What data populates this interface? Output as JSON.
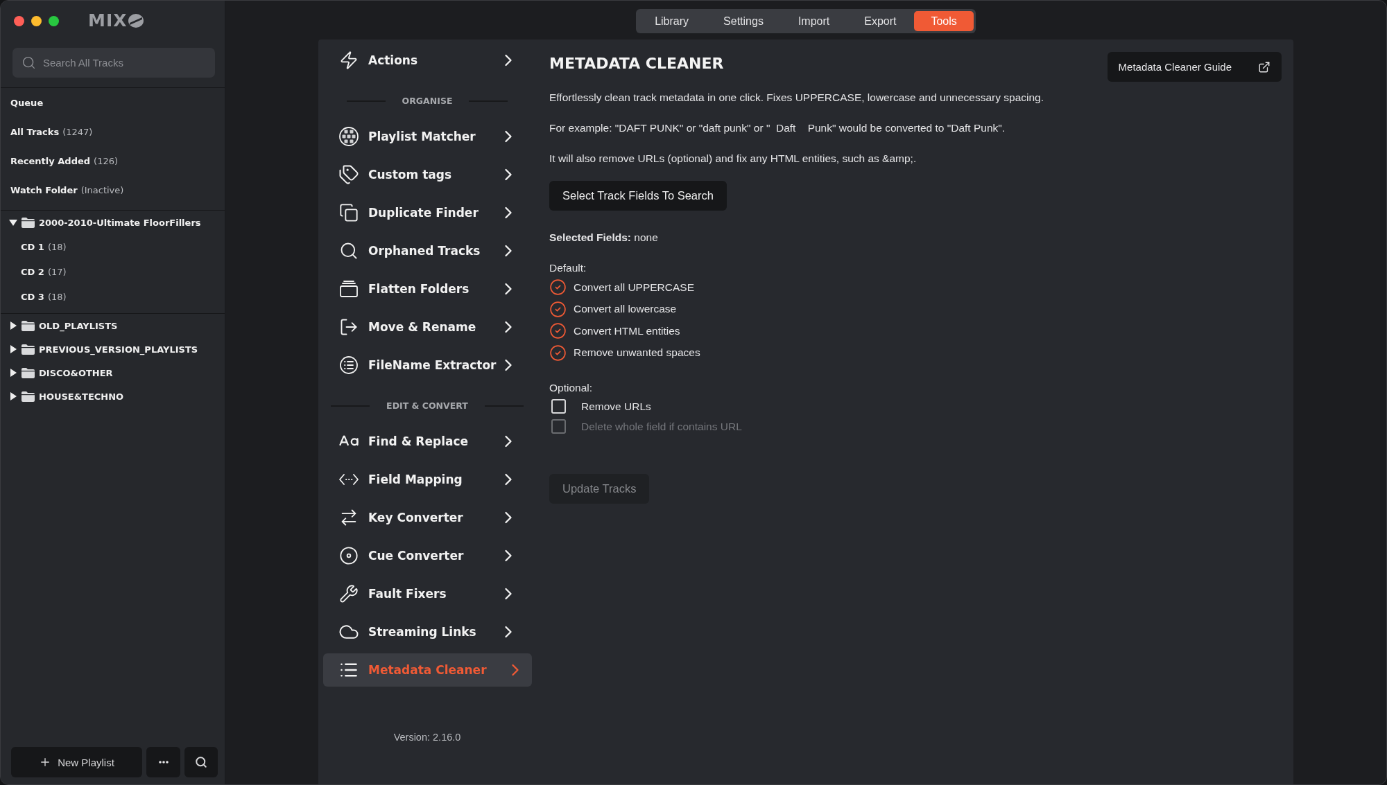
{
  "window": {
    "logo": "MIX"
  },
  "sidebar": {
    "search": {
      "placeholder": "Search All Tracks"
    },
    "library": [
      {
        "label": "Queue"
      },
      {
        "label": "All Tracks",
        "count": "(1247)"
      },
      {
        "label": "Recently Added",
        "count": "(126)"
      },
      {
        "label": "Watch Folder",
        "count": "(Inactive)"
      }
    ],
    "playlists": [
      {
        "name": "2000-2010-Ultimate FloorFillers",
        "expanded": true,
        "children": [
          {
            "label": "CD 1",
            "count": "(18)"
          },
          {
            "label": "CD 2",
            "count": "(17)"
          },
          {
            "label": "CD 3",
            "count": "(18)"
          }
        ]
      },
      {
        "name": "OLD_PLAYLISTS",
        "expanded": false
      },
      {
        "name": "PREVIOUS_VERSION_PLAYLISTS",
        "expanded": false
      },
      {
        "name": "DISCO&OTHER",
        "expanded": false
      },
      {
        "name": "HOUSE&TECHNO",
        "expanded": false
      }
    ],
    "new_playlist": "New Playlist"
  },
  "tabs": [
    {
      "label": "Library",
      "selected": false
    },
    {
      "label": "Settings",
      "selected": false
    },
    {
      "label": "Import",
      "selected": false
    },
    {
      "label": "Export",
      "selected": false
    },
    {
      "label": "Tools",
      "selected": true
    }
  ],
  "tools_menu": {
    "items": [
      {
        "kind": "item",
        "label": "Actions",
        "selected": false
      },
      {
        "kind": "heading",
        "label": "ORGANISE"
      },
      {
        "kind": "item",
        "label": "Playlist Matcher",
        "selected": false
      },
      {
        "kind": "item",
        "label": "Custom tags",
        "selected": false
      },
      {
        "kind": "item",
        "label": "Duplicate Finder",
        "selected": false
      },
      {
        "kind": "item",
        "label": "Orphaned Tracks",
        "selected": false
      },
      {
        "kind": "item",
        "label": "Flatten Folders",
        "selected": false
      },
      {
        "kind": "item",
        "label": "Move & Rename",
        "selected": false
      },
      {
        "kind": "item",
        "label": "FileName Extractor",
        "selected": false
      },
      {
        "kind": "heading",
        "label": "EDIT & CONVERT"
      },
      {
        "kind": "item",
        "label": "Find & Replace",
        "selected": false
      },
      {
        "kind": "item",
        "label": "Field Mapping",
        "selected": false
      },
      {
        "kind": "item",
        "label": "Key Converter",
        "selected": false
      },
      {
        "kind": "item",
        "label": "Cue Converter",
        "selected": false
      },
      {
        "kind": "item",
        "label": "Fault Fixers",
        "selected": false
      },
      {
        "kind": "item",
        "label": "Streaming Links",
        "selected": false
      },
      {
        "kind": "item",
        "label": "Metadata Cleaner",
        "selected": true
      }
    ],
    "version": "Version: 2.16.0"
  },
  "content": {
    "title": "METADATA CLEANER",
    "guide_button": "Metadata Cleaner Guide",
    "paragraphs": [
      "Effortlessly clean track metadata in one click. Fixes UPPERCASE, lowercase and unnecessary spacing.",
      "For example: \"DAFT PUNK\" or \"daft punk\" or \"  Daft    Punk\" would be converted to \"Daft Punk\".",
      "It will also remove URLs (optional) and fix any HTML entities, such as &amp;."
    ],
    "select_button": "Select Track Fields To Search",
    "selected_fields": {
      "label": "Selected Fields:",
      "value": "none"
    },
    "default": {
      "label": "Default:",
      "options": [
        {
          "label": "Convert all UPPERCASE",
          "checked": true
        },
        {
          "label": "Convert all lowercase",
          "checked": true
        },
        {
          "label": "Convert HTML entities",
          "checked": true
        },
        {
          "label": "Remove unwanted spaces",
          "checked": true
        }
      ]
    },
    "optional": {
      "label": "Optional:",
      "options": [
        {
          "label": "Remove URLs",
          "checked": false,
          "disabled": false
        },
        {
          "label": "Delete whole field if contains URL",
          "checked": false,
          "disabled": true
        }
      ]
    },
    "update_button": {
      "label": "Update Tracks",
      "disabled": true
    }
  }
}
